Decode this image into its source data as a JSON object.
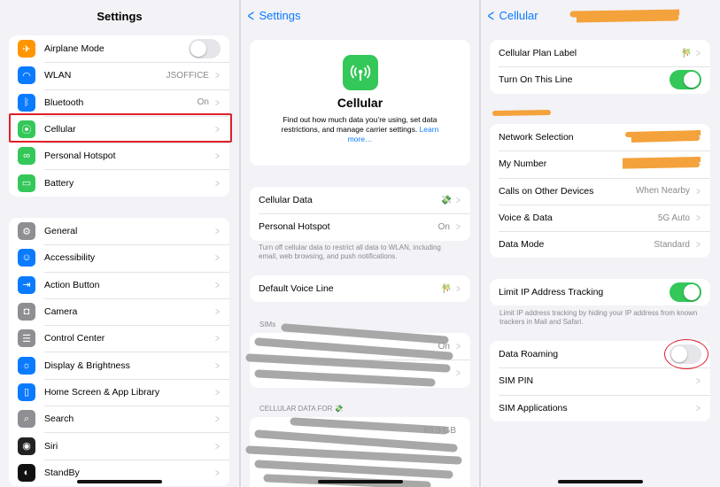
{
  "panel1": {
    "title": "Settings",
    "group1": [
      {
        "name": "airplane",
        "label": "Airplane Mode",
        "icon": "airplane-icon",
        "color": "#ff9500",
        "type": "toggle",
        "on": false
      },
      {
        "name": "wlan",
        "label": "WLAN",
        "icon": "wifi-icon",
        "color": "#0a7aff",
        "value": "JSOFFICE"
      },
      {
        "name": "bluetooth",
        "label": "Bluetooth",
        "icon": "bluetooth-icon",
        "color": "#0a7aff",
        "value": "On"
      },
      {
        "name": "cellular",
        "label": "Cellular",
        "icon": "antenna-icon",
        "color": "#34c759",
        "value": ""
      },
      {
        "name": "hotspot",
        "label": "Personal Hotspot",
        "icon": "link-icon",
        "color": "#34c759",
        "value": ""
      },
      {
        "name": "battery",
        "label": "Battery",
        "icon": "battery-icon",
        "color": "#34c759",
        "value": ""
      }
    ],
    "group2": [
      {
        "name": "general",
        "label": "General",
        "icon": "gear-icon",
        "color": "#8e8e93"
      },
      {
        "name": "accessibility",
        "label": "Accessibility",
        "icon": "accessibility-icon",
        "color": "#0a7aff"
      },
      {
        "name": "action-button",
        "label": "Action Button",
        "icon": "action-icon",
        "color": "#0a7aff"
      },
      {
        "name": "camera",
        "label": "Camera",
        "icon": "camera-icon",
        "color": "#8e8e93"
      },
      {
        "name": "control-center",
        "label": "Control Center",
        "icon": "switches-icon",
        "color": "#8e8e93"
      },
      {
        "name": "display",
        "label": "Display & Brightness",
        "icon": "sun-icon",
        "color": "#0a7aff"
      },
      {
        "name": "home-screen",
        "label": "Home Screen & App Library",
        "icon": "phone-icon",
        "color": "#0a7aff"
      },
      {
        "name": "search",
        "label": "Search",
        "icon": "search-icon",
        "color": "#8e8e93"
      },
      {
        "name": "siri",
        "label": "Siri",
        "icon": "siri-icon",
        "color": "#222222"
      },
      {
        "name": "standby",
        "label": "StandBy",
        "icon": "standby-icon",
        "color": "#111111"
      }
    ]
  },
  "panel2": {
    "back": "Settings",
    "hero_title": "Cellular",
    "hero_desc": "Find out how much data you’re using, set data restrictions, and manage carrier settings.",
    "hero_link": "Learn more…",
    "group1": [
      {
        "name": "cellular-data",
        "label": "Cellular Data",
        "value": "",
        "flag": "💸"
      },
      {
        "name": "personal-hotspot",
        "label": "Personal Hotspot",
        "value": "On"
      }
    ],
    "note1": "Turn off cellular data to restrict all data to WLAN, including email, web browsing, and push notifications.",
    "group2": [
      {
        "name": "default-voice-line",
        "label": "Default Voice Line",
        "value": "",
        "flag": "🎋"
      }
    ],
    "sims_header": "SIMs",
    "sims_row_value": "On",
    "data_for_header": "CELLULAR DATA FOR 💸",
    "data_usage_value": "83.9 GB"
  },
  "panel3": {
    "back": "Cellular",
    "group1": [
      {
        "name": "plan-label",
        "label": "Cellular Plan Label",
        "flag": "🎋",
        "type": "chevron"
      },
      {
        "name": "turn-on-line",
        "label": "Turn On This Line",
        "type": "toggle",
        "on": true
      }
    ],
    "group2": [
      {
        "name": "network-selection",
        "label": "Network Selection",
        "value": "",
        "type": "chevron"
      },
      {
        "name": "my-number",
        "label": "My Number",
        "value": "",
        "type": "chevron"
      },
      {
        "name": "calls-other-devices",
        "label": "Calls on Other Devices",
        "value": "When Nearby",
        "type": "chevron"
      },
      {
        "name": "voice-data",
        "label": "Voice & Data",
        "value": "5G Auto",
        "type": "chevron"
      },
      {
        "name": "data-mode",
        "label": "Data Mode",
        "value": "Standard",
        "type": "chevron"
      }
    ],
    "group3": [
      {
        "name": "limit-ip-tracking",
        "label": "Limit IP Address Tracking",
        "type": "toggle",
        "on": true
      }
    ],
    "note3": "Limit IP address tracking by hiding your IP address from known trackers in Mail and Safari.",
    "group4": [
      {
        "name": "data-roaming",
        "label": "Data Roaming",
        "type": "toggle",
        "on": false
      },
      {
        "name": "sim-pin",
        "label": "SIM PIN",
        "type": "chevron"
      },
      {
        "name": "sim-applications",
        "label": "SIM Applications",
        "type": "chevron"
      }
    ]
  },
  "colors": {
    "accent": "#0a7aff",
    "toggle_on": "#34c759",
    "highlight": "#e0202c",
    "redaction": "#f4a23c"
  }
}
